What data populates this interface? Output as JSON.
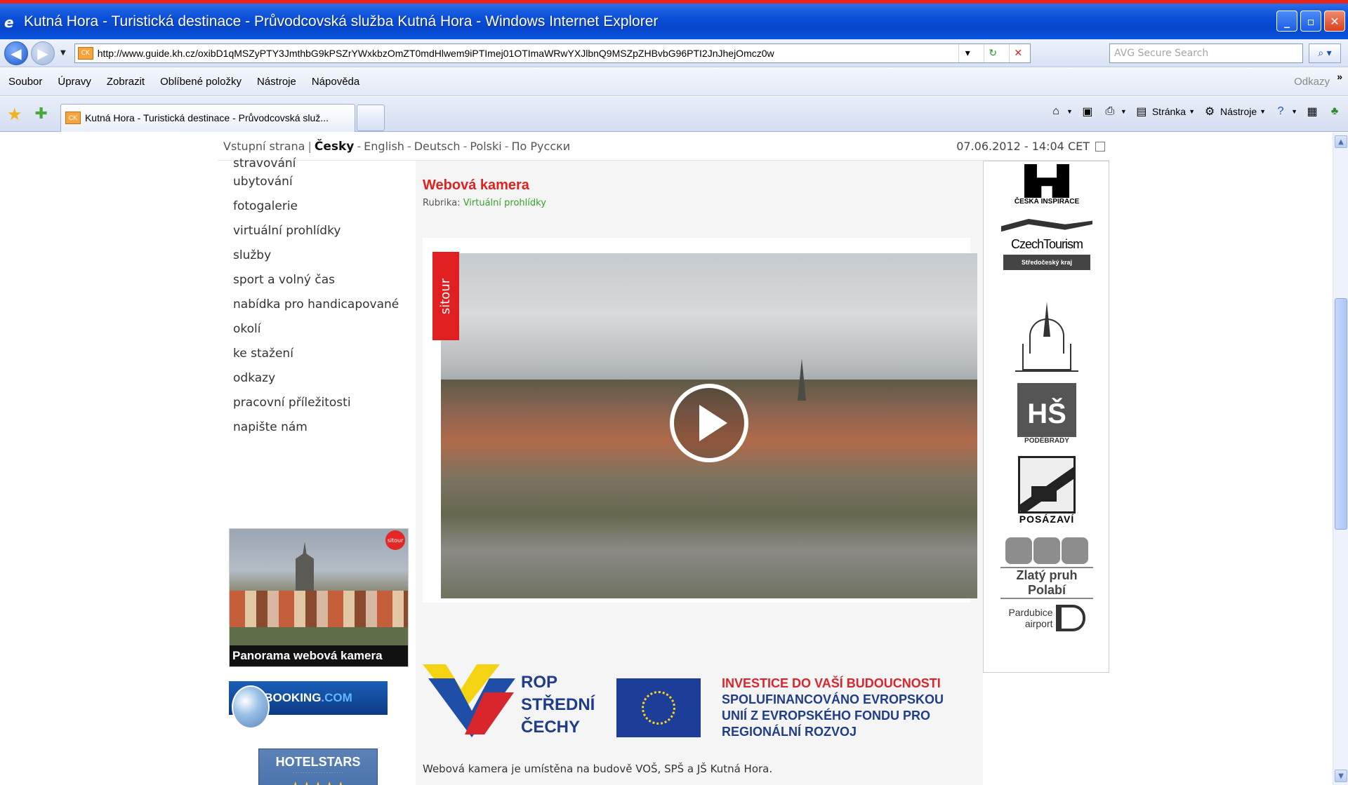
{
  "window": {
    "title": "Kutná Hora - Turistická destinace - Průvodcovská služba Kutná Hora - Windows Internet Explorer",
    "buttons": {
      "minimize": "_",
      "maximize": "▫",
      "close": "✕"
    }
  },
  "address_bar": {
    "url": "http://www.guide.kh.cz/oxibD1qMSZyPTY3JmthbG9kPSZrYWxkbzOmZT0mdHlwem9iPTImej01OTImaWRwYXJlbnQ9MSZpZHBvbG96PTI2JnJhejOmcz0w",
    "favicon": "CK",
    "search_placeholder": "AVG Secure Search"
  },
  "menu": {
    "items": [
      "Soubor",
      "Úpravy",
      "Zobrazit",
      "Oblíbené položky",
      "Nástroje",
      "Nápověda"
    ],
    "links_label": "Odkazy",
    "more": "»"
  },
  "tab": {
    "favicon": "CK",
    "label": "Kutná Hora - Turistická destinace - Průvodcovská služ..."
  },
  "commands": {
    "page": "Stránka",
    "tools": "Nástroje"
  },
  "site": {
    "langs": {
      "home": "Vstupní strana",
      "sep": "|",
      "czech": "Česky",
      "english": "English",
      "german": "Deutsch",
      "polish": "Polski",
      "russian": "По Русски",
      "dash": "-"
    },
    "datetime": "07.06.2012 - 14:04 CET",
    "left_menu": [
      "stravování",
      "ubytování",
      "fotogalerie",
      "virtuální prohlídky",
      "služby",
      "sport a volný čas",
      "nabídka pro handicapované",
      "okolí",
      "ke stažení",
      "odkazy",
      "pracovní příležitosti",
      "napište nám"
    ],
    "pano_caption": "Panorama webová kamera",
    "pano_badge": "sitour",
    "booking": {
      "main": "BOOKING",
      "dom": ".COM"
    },
    "hotelstars": {
      "title": "HOTELSTARS",
      "stars": "★★★★★"
    },
    "article": {
      "title": "Webová kamera",
      "rubric_label": "Rubrika:",
      "rubric_value": "Virtuální prohlídky",
      "video_brand": "sitour",
      "footer_text": "Webová kamera je umístěna na budově VOŠ, SPŠ a JŠ Kutná Hora."
    },
    "rop": {
      "line1": "ROP",
      "line2": "STŘEDNÍ",
      "line3": "ČECHY",
      "inv1": "INVESTICE DO VAŠÍ BUDOUCNOSTI",
      "inv2": "SPOLUFINANCOVÁNO EVROPSKOU",
      "inv3": "UNIÍ Z EVROPSKÉHO FONDU PRO",
      "inv4": "REGIONÁLNÍ ROZVOJ"
    },
    "logos": {
      "ceska_inspirace": "ČESKÁ INSPIRACE",
      "czechtourism": "CzechTourism",
      "stredocesky": "Středočeský kraj",
      "hs": "HŠ",
      "podebrady": "PODĚBRADY",
      "posazavi": "POSÁZAVÍ",
      "zlaty_pruh": "Zlatý pruh Polabí",
      "pardubice1": "Pardubice",
      "pardubice2": "airport"
    }
  }
}
